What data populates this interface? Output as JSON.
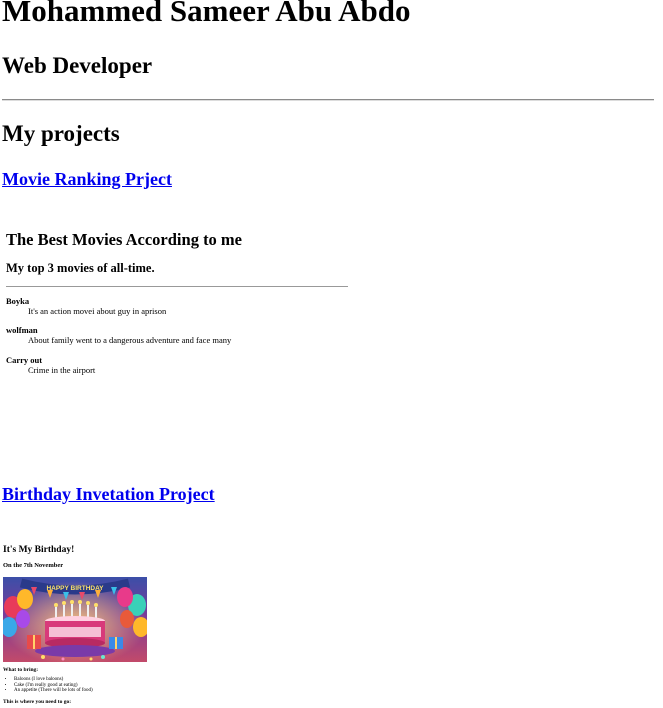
{
  "header": {
    "name": "Mohammed Sameer Abu Abdo",
    "role": "Web Developer"
  },
  "projects_section": {
    "title": "My projects"
  },
  "projects": [
    {
      "link_label": "Movie Ranking Prject",
      "embed": {
        "title": "The Best Movies According to me",
        "subtitle": "My top 3 movies of all-time.",
        "movies": [
          {
            "name": "Boyka",
            "description": "It's an action movei about guy in aprison"
          },
          {
            "name": "wolfman",
            "description": "About family went to a dangerous adventure and face many"
          },
          {
            "name": "Carry out",
            "description": "Crime in the airport"
          }
        ]
      }
    },
    {
      "link_label": "Birthday Invetation Project",
      "embed": {
        "title": "It's My Birthday!",
        "date": "On the 7th November",
        "image_alt": "birthday cake with balloons",
        "image_text": "HAPPY BIRTHDAY",
        "bring_label": "What to bring:",
        "items": [
          "Baloons (I love baloons)",
          "Cake (I'm really good at eating)",
          "An appetite (There will be lots of food)"
        ],
        "where_label": "This is where you need to go:"
      }
    }
  ],
  "colors": {
    "link": "#0000ee",
    "rule": "#8a8a8a",
    "text": "#000000",
    "background": "#ffffff"
  }
}
